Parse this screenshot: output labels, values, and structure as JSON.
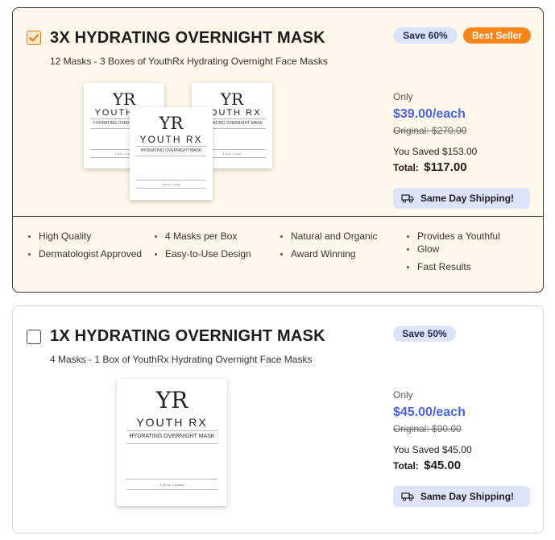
{
  "options": [
    {
      "title": "3X HYDRATING OVERNIGHT MASK",
      "subtitle": "12 Masks - 3 Boxes of YouthRx Hydrating Overnight Face Masks",
      "checked": true,
      "badges": [
        "Save 60%",
        "Best Seller"
      ],
      "only_label": "Only",
      "price_each": "$39.00/each",
      "original": "Original: $270.00",
      "saved": "You Saved $153.00",
      "total_label": "Total:",
      "total_value": "$117.00",
      "shipping": "Same Day Shipping!",
      "features": [
        "High Quality",
        "Dermatologist Approved",
        "4 Masks per Box",
        "Easy-to-Use Design",
        "Natural and Organic",
        "Award Winning",
        "Provides a Youthful",
        "Glow",
        "Fast Results"
      ]
    },
    {
      "title": "1X HYDRATING OVERNIGHT MASK",
      "subtitle": "4 Masks - 1 Box of YouthRx Hydrating Overnight Face Masks",
      "checked": false,
      "badges": [
        "Save 50%"
      ],
      "only_label": "Only",
      "price_each": "$45.00/each",
      "original": "Original: $90.00",
      "saved": "You Saved $45.00",
      "total_label": "Total:",
      "total_value": "$45.00",
      "shipping": "Same Day Shipping!"
    }
  ],
  "product_box": {
    "logo": "YR",
    "brand": "YOUTH RX",
    "product": "HYDRATING OVERNIGHT MASK",
    "size": "1.19 oz. x 4 each"
  },
  "colors": {
    "accent_price": "#4b63e0",
    "best_seller": "#f7851a",
    "selected_bg": "#fff8ea",
    "badge_bg": "#dde3fb"
  }
}
